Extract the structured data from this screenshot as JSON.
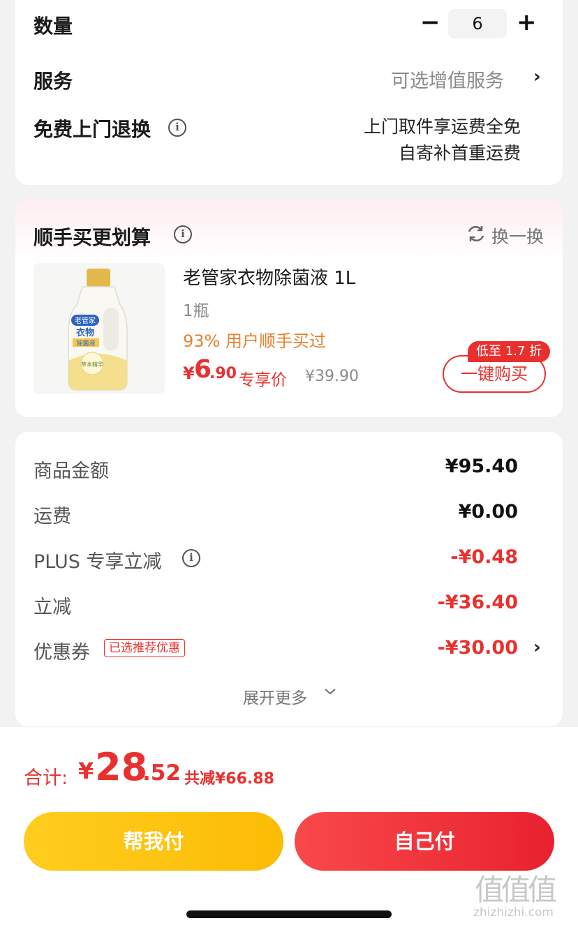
{
  "quantity": {
    "label": "数量",
    "minus": "−",
    "value": "6",
    "plus": "+"
  },
  "service": {
    "label": "服务",
    "value": "可选增值服务",
    "chevron": "›"
  },
  "return": {
    "label": "免费上门退换",
    "line1": "上门取件享运费全免",
    "line2": "自寄补首重运费"
  },
  "addon": {
    "title": "顺手买更划算",
    "refresh": "换一换",
    "product": {
      "name": "老管家衣物除菌液 1L",
      "spec": "1瓶",
      "social": "93% 用户顺手买过",
      "currency": "¥",
      "price_int": "6",
      "price_dec": ".90",
      "price_tag": "专享价",
      "orig_price": "¥39.90",
      "badge": "低至 1.7 折",
      "buy": "一键购买",
      "image_text": {
        "brand": "老管家",
        "type": "衣物",
        "sub": "除菌液",
        "herb": "草本精华"
      }
    }
  },
  "summary": {
    "rows": [
      {
        "label": "商品金额",
        "value": "¥95.40"
      },
      {
        "label": "运费",
        "value": "¥0.00"
      },
      {
        "label": "PLUS 专享立减",
        "value": "-¥0.48"
      },
      {
        "label": "立减",
        "value": "-¥36.40"
      },
      {
        "label": "优惠券",
        "tag": "已选推荐优惠",
        "value": "-¥30.00",
        "chevron": "›"
      }
    ],
    "expand": "展开更多"
  },
  "total": {
    "label": "合计:",
    "currency": "¥",
    "int": "28",
    "dec": ".52",
    "saved": "共减¥66.88"
  },
  "buttons": {
    "help_pay": "帮我付",
    "self_pay": "自己付"
  },
  "watermark": {
    "mark": "值值值",
    "site": "zhizhizhi.com"
  },
  "colors": {
    "accent_red": "#e8312f",
    "yellow": "#fbbc05"
  }
}
